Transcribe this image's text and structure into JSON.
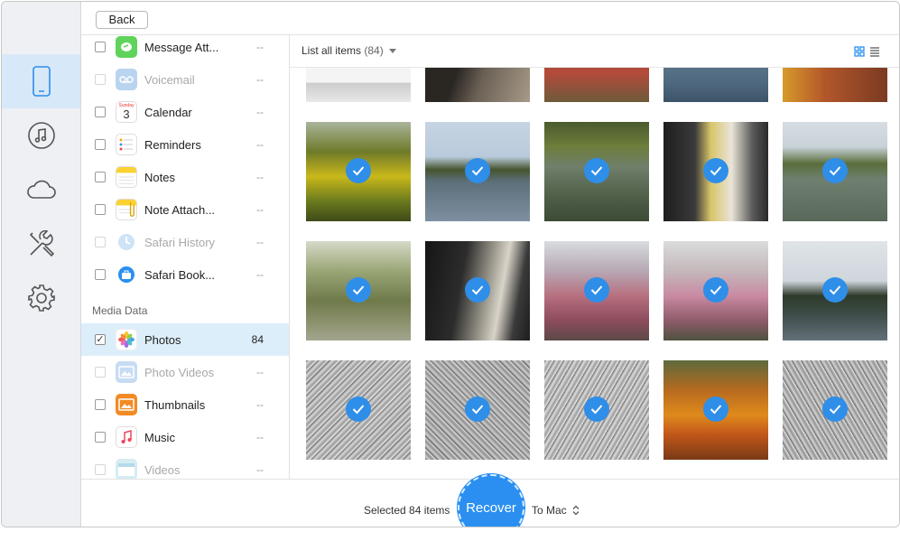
{
  "window": {
    "back_label": "Back"
  },
  "rail": {
    "items": [
      {
        "icon": "phone-icon",
        "active": true
      },
      {
        "icon": "music-icon",
        "active": false
      },
      {
        "icon": "cloud-icon",
        "active": false
      },
      {
        "icon": "tools-icon",
        "active": false
      },
      {
        "icon": "gear-icon",
        "active": false
      }
    ]
  },
  "categories": [
    {
      "label": "Message Att...",
      "count": "--",
      "disabled": false,
      "icon": "message-attachment-icon"
    },
    {
      "label": "Voicemail",
      "count": "--",
      "disabled": true,
      "icon": "voicemail-icon"
    },
    {
      "label": "Calendar",
      "count": "--",
      "disabled": false,
      "icon": "calendar-icon"
    },
    {
      "label": "Reminders",
      "count": "--",
      "disabled": false,
      "icon": "reminders-icon"
    },
    {
      "label": "Notes",
      "count": "--",
      "disabled": false,
      "icon": "notes-icon"
    },
    {
      "label": "Note Attach...",
      "count": "--",
      "disabled": false,
      "icon": "note-attachment-icon"
    },
    {
      "label": "Safari History",
      "count": "--",
      "disabled": true,
      "icon": "safari-history-icon"
    },
    {
      "label": "Safari Book...",
      "count": "--",
      "disabled": false,
      "icon": "safari-bookmark-icon"
    }
  ],
  "media_section": {
    "label": "Media Data",
    "items": [
      {
        "label": "Photos",
        "count": "84",
        "disabled": false,
        "selected": true,
        "checked": true,
        "icon": "photos-icon"
      },
      {
        "label": "Photo Videos",
        "count": "--",
        "disabled": true,
        "icon": "photo-videos-icon"
      },
      {
        "label": "Thumbnails",
        "count": "--",
        "disabled": false,
        "icon": "thumbnails-icon"
      },
      {
        "label": "Music",
        "count": "--",
        "disabled": false,
        "icon": "music-note-icon"
      },
      {
        "label": "Videos",
        "count": "--",
        "disabled": true,
        "icon": "videos-icon"
      }
    ]
  },
  "content": {
    "list_label": "List all items",
    "list_count": "(84)"
  },
  "footer": {
    "selected_text": "Selected 84 items",
    "recover_label": "Recover",
    "destination": "To Mac"
  },
  "colors": {
    "accent": "#2a8ff0",
    "selected_row": "#ddeefb",
    "rail_active": "#d7e8f9"
  }
}
